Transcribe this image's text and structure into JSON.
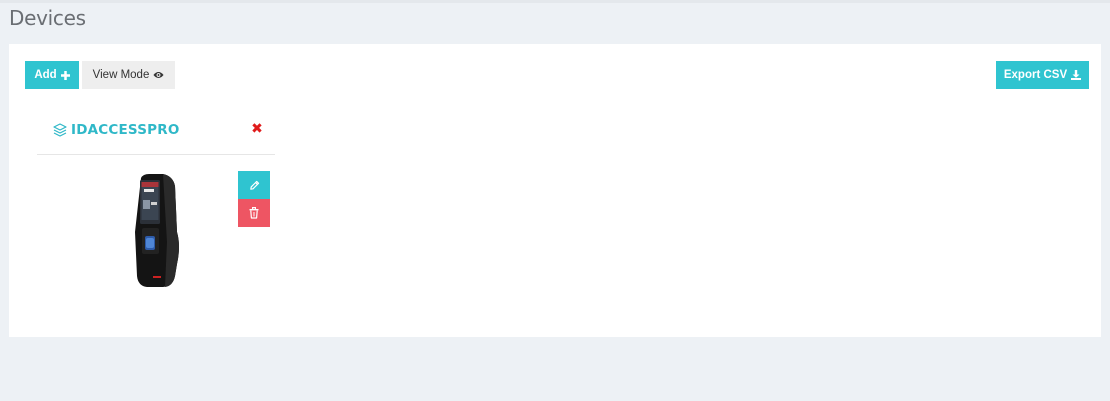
{
  "page": {
    "title": "Devices"
  },
  "toolbar": {
    "add_label": "Add",
    "add_icon": "plus-icon",
    "view_mode_label": "View Mode",
    "view_mode_icon": "eye-icon",
    "export_label": "Export CSV",
    "export_icon": "download-icon"
  },
  "devices": [
    {
      "name": "IDACCESSPRO",
      "icon": "layers-icon",
      "remove_icon": "close-icon",
      "edit_icon": "pencil-icon",
      "delete_icon": "trash-icon"
    }
  ],
  "colors": {
    "accent": "#2fc4d0",
    "danger": "#ee5563",
    "close": "#e01b1b",
    "background": "#edf1f5"
  }
}
